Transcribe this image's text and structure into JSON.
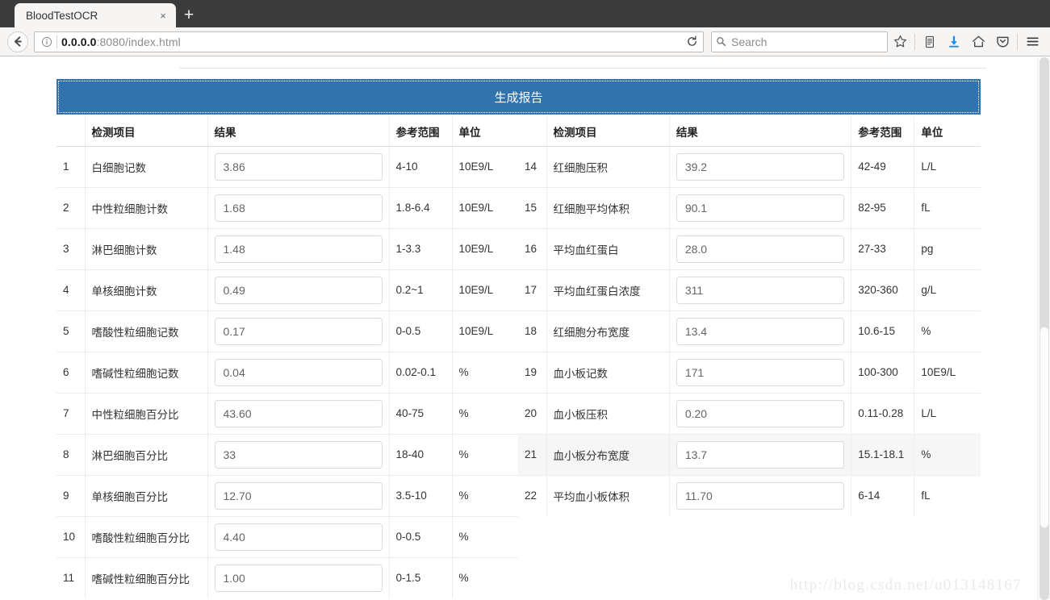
{
  "browser": {
    "tab": {
      "title": "BloodTestOCR",
      "close_label": "×"
    },
    "new_tab_label": "+",
    "back_icon": "back-arrow-icon",
    "identity_icon": "info-icon",
    "url": {
      "host": "0.0.0.0",
      "rest": ":8080/index.html"
    },
    "reload_icon": "reload-icon",
    "search": {
      "placeholder": "Search",
      "icon": "search-icon"
    },
    "toolbar_icons": [
      "star-icon",
      "library-icon",
      "download-icon",
      "home-icon",
      "pocket-icon",
      "hamburger-menu-icon"
    ]
  },
  "page": {
    "generate_button": "生成报告",
    "watermark": "http://blog.csdn.net/u013148167",
    "accent_color": "#3272ad",
    "headers": [
      "",
      "检测项目",
      "结果",
      "参考范围",
      "单位"
    ],
    "left_rows": [
      {
        "idx": "1",
        "name": "白细胞记数",
        "result": "3.86",
        "ref": "4-10",
        "unit": "10E9/L",
        "highlight": false
      },
      {
        "idx": "2",
        "name": "中性粒细胞计数",
        "result": "1.68",
        "ref": "1.8-6.4",
        "unit": "10E9/L",
        "highlight": false
      },
      {
        "idx": "3",
        "name": "淋巴细胞计数",
        "result": "1.48",
        "ref": "1-3.3",
        "unit": "10E9/L",
        "highlight": false
      },
      {
        "idx": "4",
        "name": "单核细胞计数",
        "result": "0.49",
        "ref": "0.2~1",
        "unit": "10E9/L",
        "highlight": false
      },
      {
        "idx": "5",
        "name": "嗜酸性粒细胞记数",
        "result": "0.17",
        "ref": "0-0.5",
        "unit": "10E9/L",
        "highlight": false
      },
      {
        "idx": "6",
        "name": "嗜碱性粒细胞记数",
        "result": "0.04",
        "ref": "0.02-0.1",
        "unit": "%",
        "highlight": false
      },
      {
        "idx": "7",
        "name": "中性粒细胞百分比",
        "result": "43.60",
        "ref": "40-75",
        "unit": "%",
        "highlight": false
      },
      {
        "idx": "8",
        "name": "淋巴细胞百分比",
        "result": "33",
        "ref": "18-40",
        "unit": "%",
        "highlight": false
      },
      {
        "idx": "9",
        "name": "单核细胞百分比",
        "result": "12.70",
        "ref": "3.5-10",
        "unit": "%",
        "highlight": false
      },
      {
        "idx": "10",
        "name": "嗜酸性粒细胞百分比",
        "result": "4.40",
        "ref": "0-0.5",
        "unit": "%",
        "highlight": false
      },
      {
        "idx": "11",
        "name": "嗜碱性粒细胞百分比",
        "result": "1.00",
        "ref": "0-1.5",
        "unit": "%",
        "highlight": false
      }
    ],
    "right_rows": [
      {
        "idx": "14",
        "name": "红细胞压积",
        "result": "39.2",
        "ref": "42-49",
        "unit": "L/L",
        "highlight": false
      },
      {
        "idx": "15",
        "name": "红细胞平均体积",
        "result": "90.1",
        "ref": "82-95",
        "unit": "fL",
        "highlight": false
      },
      {
        "idx": "16",
        "name": "平均血红蛋白",
        "result": "28.0",
        "ref": "27-33",
        "unit": "pg",
        "highlight": false
      },
      {
        "idx": "17",
        "name": "平均血红蛋白浓度",
        "result": "311",
        "ref": "320-360",
        "unit": "g/L",
        "highlight": false
      },
      {
        "idx": "18",
        "name": "红细胞分布宽度",
        "result": "13.4",
        "ref": "10.6-15",
        "unit": "%",
        "highlight": false
      },
      {
        "idx": "19",
        "name": "血小板记数",
        "result": "171",
        "ref": "100-300",
        "unit": "10E9/L",
        "highlight": false
      },
      {
        "idx": "20",
        "name": "血小板压积",
        "result": "0.20",
        "ref": "0.11-0.28",
        "unit": "L/L",
        "highlight": false
      },
      {
        "idx": "21",
        "name": "血小板分布宽度",
        "result": "13.7",
        "ref": "15.1-18.1",
        "unit": "%",
        "highlight": true
      },
      {
        "idx": "22",
        "name": "平均血小板体积",
        "result": "11.70",
        "ref": "6-14",
        "unit": "fL",
        "highlight": false
      }
    ]
  }
}
